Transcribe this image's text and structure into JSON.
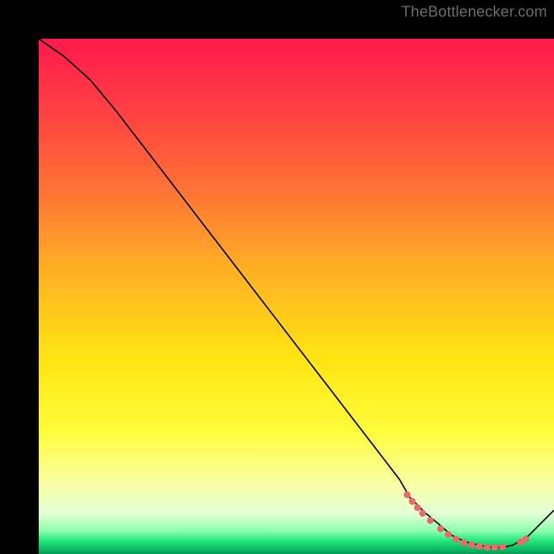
{
  "attribution": "TheBottlenecker.com",
  "chart_data": {
    "type": "line",
    "title": "",
    "xlabel": "",
    "ylabel": "",
    "xlim": [
      0,
      100
    ],
    "ylim": [
      0,
      100
    ],
    "grid": false,
    "background_gradient": {
      "stops": [
        {
          "offset": 0.0,
          "color": "#ff1a4c"
        },
        {
          "offset": 0.12,
          "color": "#ff3a45"
        },
        {
          "offset": 0.28,
          "color": "#ff6e36"
        },
        {
          "offset": 0.45,
          "color": "#ffb024"
        },
        {
          "offset": 0.62,
          "color": "#ffe412"
        },
        {
          "offset": 0.76,
          "color": "#fffc3a"
        },
        {
          "offset": 0.86,
          "color": "#faffa0"
        },
        {
          "offset": 0.92,
          "color": "#e6ffd6"
        },
        {
          "offset": 0.955,
          "color": "#8dffb0"
        },
        {
          "offset": 0.975,
          "color": "#22e57a"
        },
        {
          "offset": 1.0,
          "color": "#009e55"
        }
      ]
    },
    "series": [
      {
        "name": "curve",
        "color": "#000000",
        "stroke_width": 2,
        "x": [
          0,
          5,
          10,
          15,
          20,
          25,
          30,
          35,
          40,
          45,
          50,
          55,
          60,
          65,
          70,
          72,
          75,
          78,
          80,
          83,
          86,
          88,
          90,
          92,
          95,
          100
        ],
        "y": [
          100,
          96.5,
          92,
          86,
          79.5,
          73,
          66.5,
          60,
          53.5,
          47,
          40.5,
          34,
          27.5,
          21,
          14.5,
          11,
          8,
          5.5,
          3.7,
          2.3,
          1.6,
          1.3,
          1.3,
          1.7,
          3.5,
          8.5
        ]
      }
    ],
    "markers": {
      "name": "bottom-cluster",
      "color": "#e86a6a",
      "radius": 5,
      "points": [
        {
          "x": 71.5,
          "y": 11.5
        },
        {
          "x": 72.5,
          "y": 10.2
        },
        {
          "x": 73.5,
          "y": 9.0
        },
        {
          "x": 74.5,
          "y": 7.9
        },
        {
          "x": 76.0,
          "y": 6.5
        },
        {
          "x": 78.0,
          "y": 4.9
        },
        {
          "x": 79.5,
          "y": 3.8
        },
        {
          "x": 81.0,
          "y": 2.9
        },
        {
          "x": 82.5,
          "y": 2.2
        },
        {
          "x": 84.0,
          "y": 1.8
        },
        {
          "x": 85.5,
          "y": 1.5
        },
        {
          "x": 87.0,
          "y": 1.3
        },
        {
          "x": 88.5,
          "y": 1.3
        },
        {
          "x": 90.0,
          "y": 1.4
        },
        {
          "x": 93.5,
          "y": 2.3
        },
        {
          "x": 94.5,
          "y": 2.9
        }
      ]
    }
  }
}
